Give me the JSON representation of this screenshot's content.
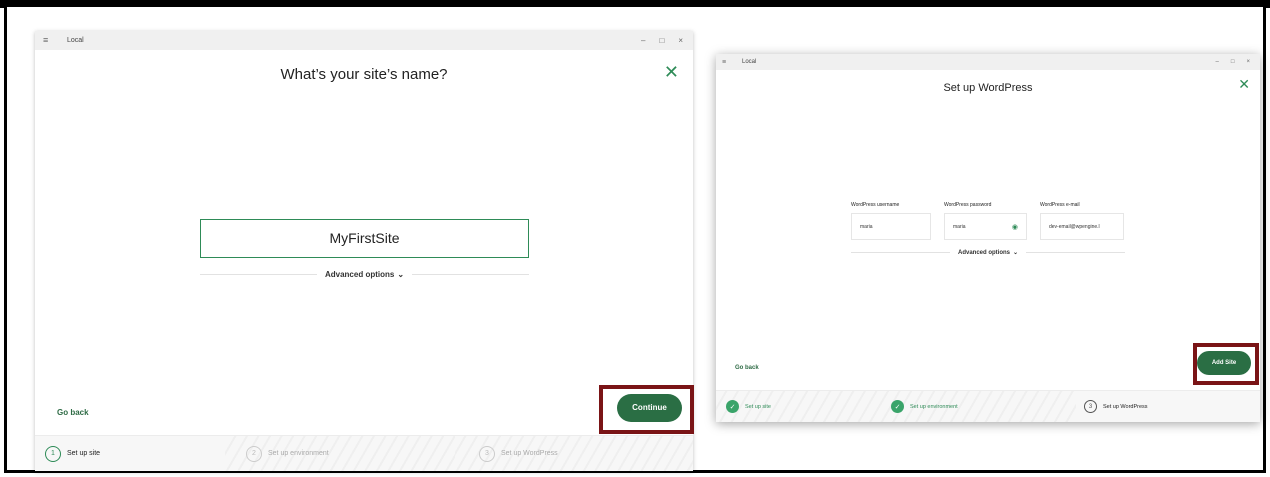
{
  "window1": {
    "app_title": "Local",
    "menu_icon": "hamburger-icon",
    "controls": [
      "–",
      "□",
      "×"
    ],
    "heading": "What’s your site’s name?",
    "site_name_value": "MyFirstSite",
    "advanced_options": "Advanced options",
    "go_back": "Go back",
    "continue_label": "Continue",
    "steps": [
      {
        "num": "1",
        "label": "Set up site",
        "state": "active"
      },
      {
        "num": "2",
        "label": "Set up environment",
        "state": "inactive"
      },
      {
        "num": "3",
        "label": "Set up WordPress",
        "state": "inactive"
      }
    ]
  },
  "window2": {
    "app_title": "Local",
    "controls": [
      "–",
      "□",
      "×"
    ],
    "heading": "Set up WordPress",
    "fields": [
      {
        "label": "WordPress username",
        "value": "maria"
      },
      {
        "label": "WordPress password",
        "value": "maria"
      },
      {
        "label": "WordPress e-mail",
        "value": "dev-email@wpengine.l"
      }
    ],
    "advanced_options": "Advanced options",
    "go_back": "Go back",
    "add_site_label": "Add Site",
    "steps": [
      {
        "label": "Set up site",
        "state": "done"
      },
      {
        "label": "Set up environment",
        "state": "done"
      },
      {
        "num": "3",
        "label": "Set up WordPress",
        "state": "active"
      }
    ]
  },
  "colors": {
    "brand_green": "#2a6e44",
    "highlight": "#7a1416"
  }
}
